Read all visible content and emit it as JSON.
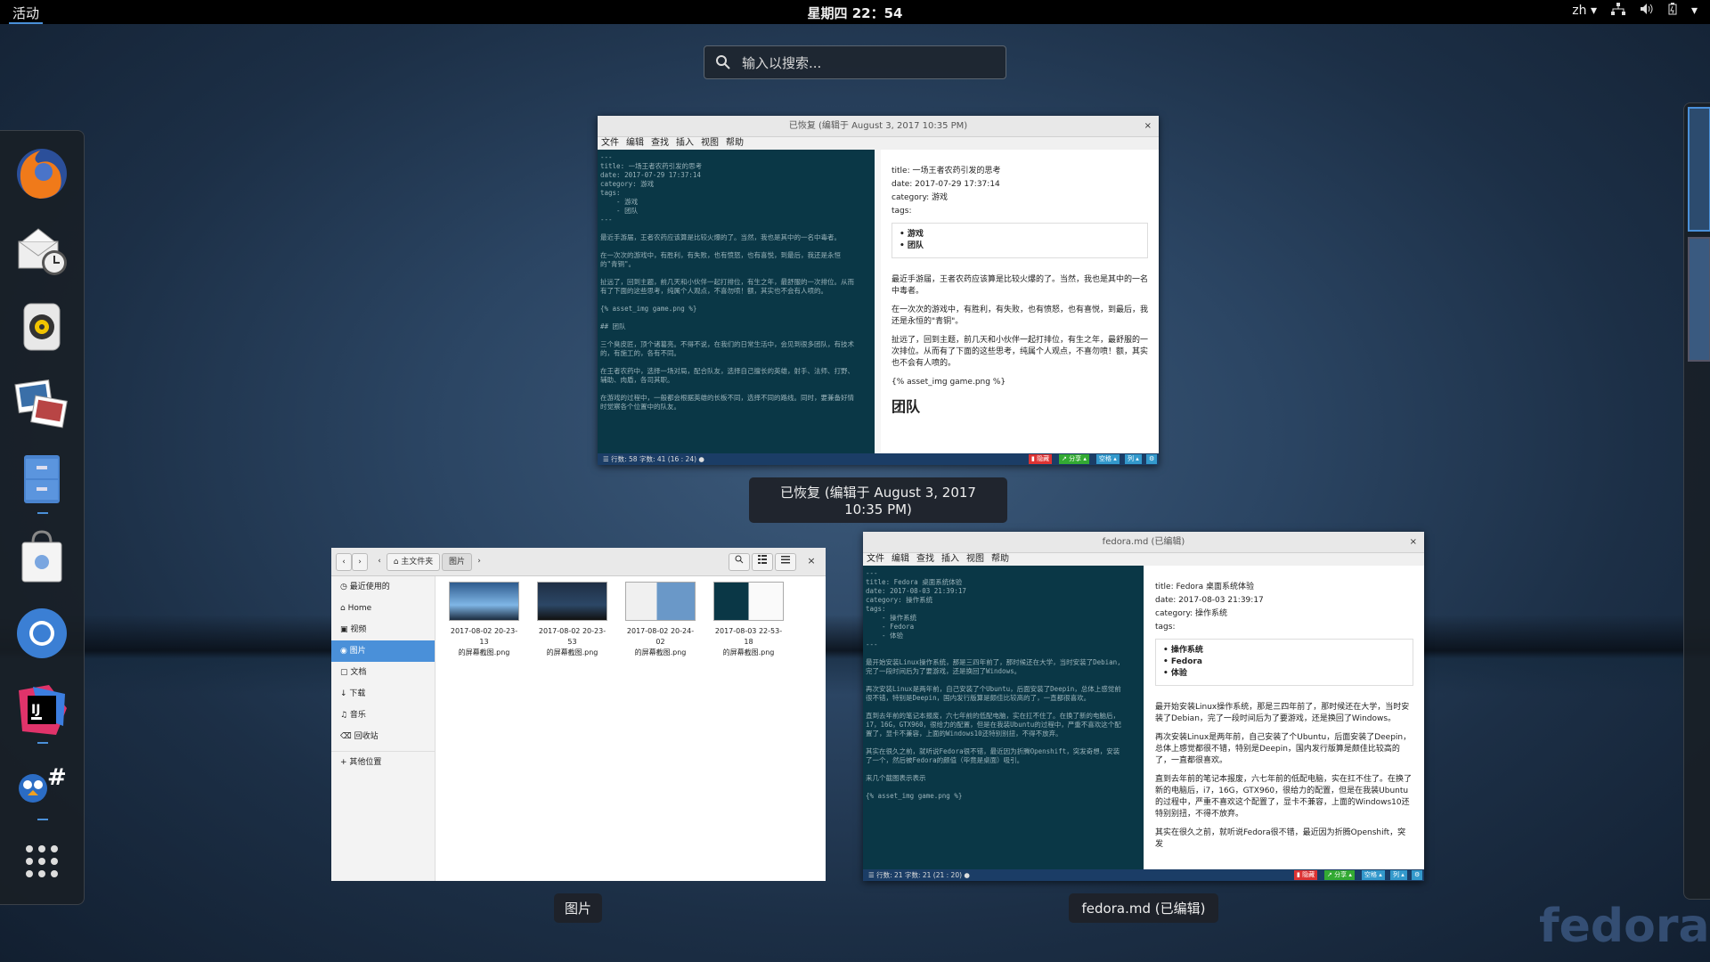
{
  "topbar": {
    "activities": "活动",
    "clock": "星期四 22：54",
    "lang": "zh ▾"
  },
  "search": {
    "placeholder": "输入以搜索..."
  },
  "dash": {
    "apps": [
      "firefox",
      "evolution",
      "rhythmbox",
      "shotwell",
      "files",
      "software",
      "chromium",
      "intellij-idea",
      "mono-develop",
      "show-apps"
    ]
  },
  "win_top": {
    "title": "已恢复 (编辑于 August 3, 2017 10:35 PM)",
    "close": "×",
    "menu": [
      "文件",
      "编辑",
      "查找",
      "插入",
      "视图",
      "帮助"
    ],
    "editor_text": "---\ntitle: 一场王者农药引发的思考\ndate: 2017-07-29 17:37:14\ncategory: 游戏\ntags:\n    - 游戏\n    - 团队\n---\n\n最近手游届，王者农药应该算是比较火爆的了。当然，我也是其中的一名中毒者。\n\n在一次次的游戏中，有胜利，有失败，也有愤怒，也有喜悦，到最后，我还是永恒\n的\"青铜\"。\n\n扯远了，回到主题，前几天和小伙伴一起打排位，有生之年，最舒服的一次排位。从而\n有了下面的这些思考，纯属个人观点，不喜勿喷！额，其实也不会有人喷的。\n\n{% asset_img game.png %}\n\n## 团队\n\n三个臭皮匠，顶个诸葛亮。不得不说，在我们的日常生活中，会见到很多团队，有技术\n的，有施工的，各有不同。\n\n在王者农药中，选择一场对局，配合队友，选择自己擅长的英雄，射手、法师、打野、\n辅助、肉盾，各司其职。\n\n在游戏的过程中，一般都会根据英雄的长板不同，选择不同的路线。同时，要兼备好情\n时觉察各个位置中的队友。",
    "preview": {
      "title_line": "title: 一场王者农药引发的思考",
      "date_line": "date: 2017-07-29 17:37:14",
      "category_line": "category: 游戏",
      "tags_line": "tags:",
      "tag1": "游戏",
      "tag2": "团队",
      "p1": "最近手游届，王者农药应该算是比较火爆的了。当然，我也是其中的一名中毒者。",
      "p2": "在一次次的游戏中，有胜利，有失败，也有愤怒，也有喜悦，到最后，我还是永恒的\"青铜\"。",
      "p3": "扯远了，回到主题，前几天和小伙伴一起打排位，有生之年，最舒服的一次排位。从而有了下面的这些思考，纯属个人观点，不喜勿喷！额，其实也不会有人喷的。",
      "p4": "{% asset_img game.png %}",
      "heading": "团队"
    },
    "status": "☰  行数: 58   字数: 41   (16 : 24)   ●",
    "btn_red": "▮ 隐藏",
    "btn_green": "↗ 分享 ▴",
    "btn_blue1": "空格 ▴",
    "btn_blue2": "列 ▴",
    "btn_gear": "⚙",
    "caption": "已恢复 (编辑于 August 3, 2017 10:35 PM)"
  },
  "files": {
    "back": "‹",
    "forward": "›",
    "crumb_left": "‹",
    "crumb_home": "⌂ 主文件夹",
    "crumb_current": "图片",
    "crumb_right": "›",
    "close": "×",
    "sidebar": [
      "◷ 最近使用的",
      "⌂ Home",
      "▣ 视频",
      "◉ 图片",
      "▢ 文档",
      "↓ 下载",
      "♫ 音乐",
      "⌫ 回收站"
    ],
    "other": "+ 其他位置",
    "items": [
      {
        "line1": "2017-08-02 20-23-13",
        "line2": "的屏幕截图.png"
      },
      {
        "line1": "2017-08-02 20-23-53",
        "line2": "的屏幕截图.png"
      },
      {
        "line1": "2017-08-02 20-24-02",
        "line2": "的屏幕截图.png"
      },
      {
        "line1": "2017-08-03 22-53-18",
        "line2": "的屏幕截图.png"
      }
    ],
    "caption": "图片"
  },
  "win_right": {
    "title": "fedora.md (已编辑)",
    "close": "×",
    "menu": [
      "文件",
      "编辑",
      "查找",
      "插入",
      "视图",
      "帮助"
    ],
    "editor_text": "---\ntitle: Fedora 桌面系统体验\ndate: 2017-08-03 21:39:17\ncategory: 操作系统\ntags:\n    - 操作系统\n    - Fedora\n    - 体验\n---\n\n最开始安装Linux操作系统，那是三四年前了，那时候还在大学，当时安装了Debian,\n完了一段时间后为了要游戏，还是换回了Windows。\n\n再次安装Linux是两年前，自己安装了个Ubuntu，后面安装了Deepin，总体上感觉前\n很不错，特别是Deepin，国内发行版算是颇佳比较高的了，一直都很喜欢。\n\n直到去年前的笔记本报废，六七年前的低配电脑，实在扛不住了。在换了新的电脑后，\ni7，16G，GTX960，很给力的配置，但是在我装Ubuntu的过程中，严重不喜欢这个配\n置了，显卡不兼容，上面的Windows10还特别别扭，不得不放弃。\n\n其实在很久之前，就听说Fedora很不错，最近因为折腾Openshift，突发奇想，安装\n了一个，然后被Fedora的颜值（毕竟是桌面）吸引。\n\n来几个截图表示表示\n\n{% asset_img game.png %}",
    "preview": {
      "title_line": "title: Fedora 桌面系统体验",
      "date_line": "date: 2017-08-03 21:39:17",
      "category_line": "category: 操作系统",
      "tags_line": "tags:",
      "tag1": "操作系统",
      "tag2": "Fedora",
      "tag3": "体验",
      "p1": "最开始安装Linux操作系统，那是三四年前了，那时候还在大学，当时安装了Debian，完了一段时间后为了要游戏，还是换回了Windows。",
      "p2": "再次安装Linux是两年前，自己安装了个Ubuntu，后面安装了Deepin，总体上感觉都很不错，特别是Deepin，国内发行版算是颇佳比较高的了，一直都很喜欢。",
      "p3": "直到去年前的笔记本报废，六七年前的低配电脑，实在扛不住了。在换了新的电脑后，i7，16G，GTX960，很给力的配置，但是在我装Ubuntu的过程中，严重不喜欢这个配置了，显卡不兼容，上面的Windows10还特别别扭，不得不放弃。",
      "p4": "其实在很久之前，就听说Fedora很不错，最近因为折腾Openshift，突发"
    },
    "status": "☰  行数: 21   字数: 21   (21 : 20)   ●",
    "btn_red": "▮ 隐藏",
    "btn_green": "↗ 分享 ▴",
    "btn_blue1": "空格 ▴",
    "btn_blue2": "列 ▴",
    "btn_gear": "⚙",
    "caption": "fedora.md (已编辑)"
  },
  "watermark": "fedora"
}
